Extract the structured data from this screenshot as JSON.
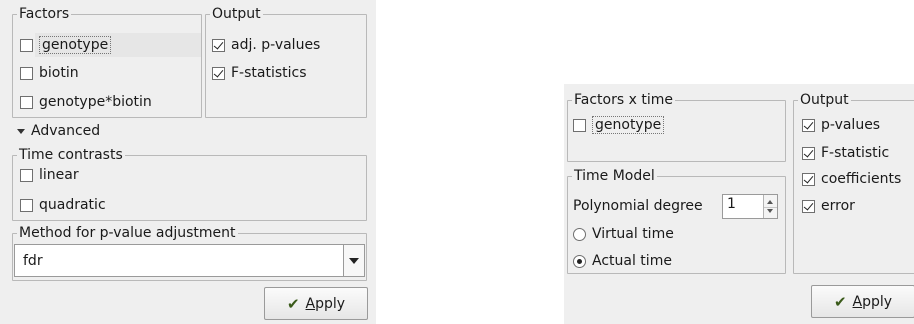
{
  "left_panel": {
    "factors": {
      "title": "Factors",
      "items": [
        {
          "label": "genotype",
          "checked": false,
          "focused": true
        },
        {
          "label": "biotin",
          "checked": false
        },
        {
          "label": "genotype*biotin",
          "checked": false
        }
      ]
    },
    "output": {
      "title": "Output",
      "items": [
        {
          "label": "adj. p-values",
          "checked": true
        },
        {
          "label": "F-statistics",
          "checked": true
        }
      ]
    },
    "advanced": {
      "label": "Advanced",
      "expanded": true
    },
    "time_contrasts": {
      "title": "Time contrasts",
      "items": [
        {
          "label": "linear",
          "checked": false
        },
        {
          "label": "quadratic",
          "checked": false
        }
      ]
    },
    "pvalue_method": {
      "title": "Method for p-value adjustment",
      "selected": "fdr"
    },
    "apply_button": {
      "prefix": "",
      "mnemonic": "A",
      "rest": "pply",
      "icon": "checkmark-icon"
    }
  },
  "right_panel": {
    "factors_x_time": {
      "title": "Factors x time",
      "items": [
        {
          "label": "genotype",
          "checked": false,
          "focused": true
        }
      ]
    },
    "time_model": {
      "title": "Time Model",
      "polynomial_label": "Polynomial degree",
      "polynomial_value": "1",
      "radios": [
        {
          "label": "Virtual time",
          "checked": false
        },
        {
          "label": "Actual time",
          "checked": true
        }
      ]
    },
    "output": {
      "title": "Output",
      "items": [
        {
          "label": "p-values",
          "checked": true
        },
        {
          "label": "F-statistic",
          "checked": true
        },
        {
          "label": "coefficients",
          "checked": true
        },
        {
          "label": "error",
          "checked": true
        }
      ]
    },
    "apply_button": {
      "mnemonic": "A",
      "rest": "pply",
      "icon": "checkmark-icon"
    }
  },
  "colors": {
    "panel_bg": "#efefef",
    "border": "#b9b9b9",
    "apply_icon": "#3a5a1a"
  }
}
